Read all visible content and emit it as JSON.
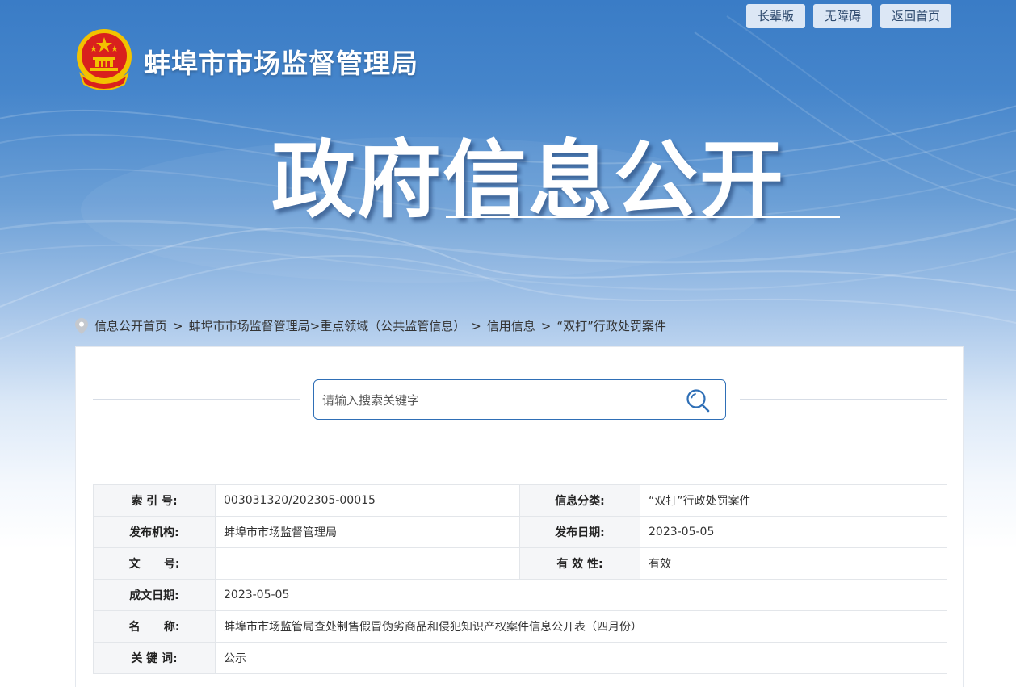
{
  "top_links": [
    "长辈版",
    "无障碍",
    "返回首页"
  ],
  "org_name": "蚌埠市市场监督管理局",
  "page_title": "政府信息公开",
  "breadcrumb": {
    "items": [
      "信息公开首页",
      "蚌埠市市场监督管理局",
      "重点领域（公共监管信息）",
      "信用信息",
      "“双打”行政处罚案件"
    ],
    "separator": ">"
  },
  "search": {
    "placeholder": "请输入搜索关键字"
  },
  "info": {
    "index_label": "索 引 号:",
    "index_value": "003031320/202305-00015",
    "category_label": "信息分类:",
    "category_value": "“双打”行政处罚案件",
    "publisher_label": "发布机构:",
    "publisher_value": "蚌埠市市场监督管理局",
    "pubdate_label": "发布日期:",
    "pubdate_value": "2023-05-05",
    "docno_label": "文      号:",
    "docno_value": "",
    "validity_label": "有 效 性:",
    "validity_value": "有效",
    "created_label": "成文日期:",
    "created_value": "2023-05-05",
    "name_label": "名      称:",
    "name_value": "蚌埠市市场监管局查处制售假冒伪劣商品和侵犯知识产权案件信息公开表（四月份）",
    "keywords_label": "关 键 词:",
    "keywords_value": "公示"
  },
  "colors": {
    "banner_top": "#3a7cc6",
    "accent_blue": "#2f6fb6",
    "label_bg": "#f5f6f8",
    "emblem_red": "#d9201d",
    "emblem_gold": "#f2c200"
  },
  "icons": [
    "national-emblem-icon",
    "location-pin-icon",
    "search-icon"
  ]
}
